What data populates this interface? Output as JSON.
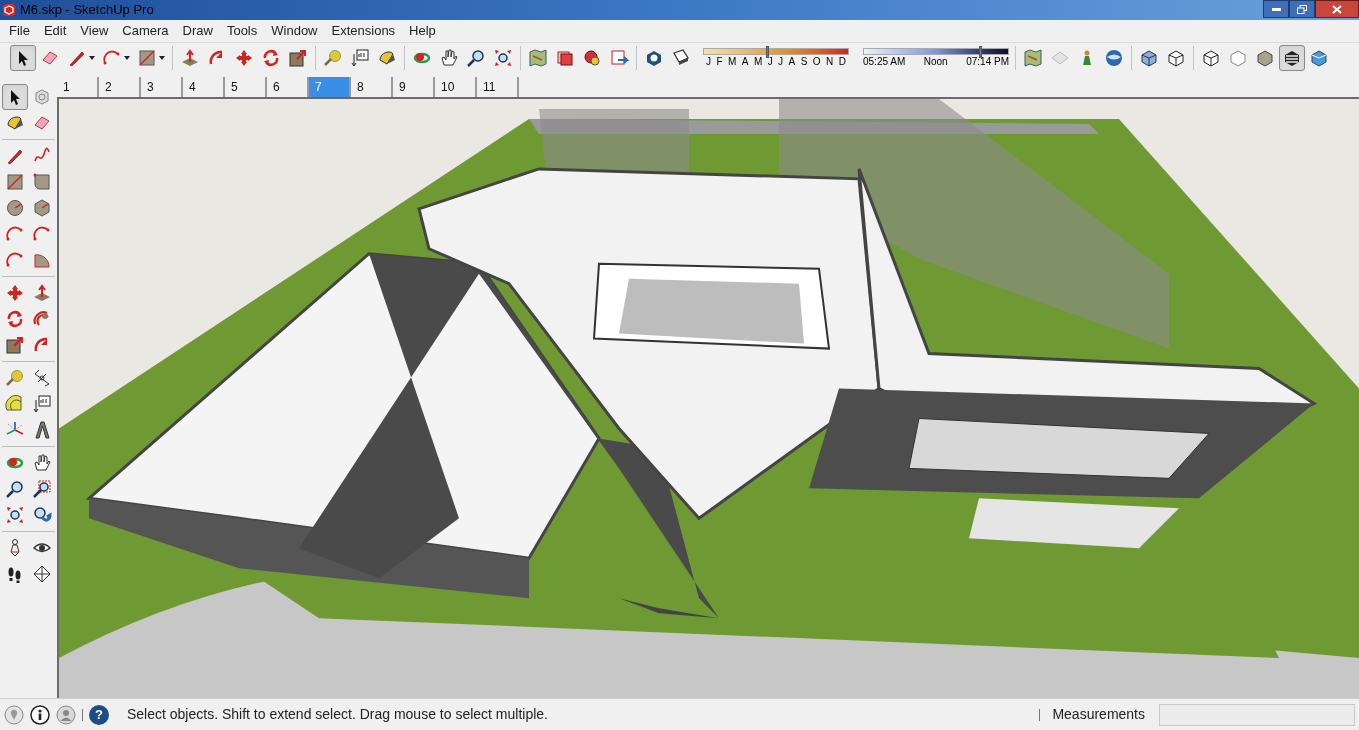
{
  "window": {
    "title": "M6.skp - SketchUp Pro"
  },
  "menu": [
    "File",
    "Edit",
    "View",
    "Camera",
    "Draw",
    "Tools",
    "Window",
    "Extensions",
    "Help"
  ],
  "toolbar_buttons": [
    {
      "selected": true
    },
    {
      "selected": false
    },
    {
      "selected": false
    },
    {
      "selected": false
    },
    {
      "selected": false
    },
    {
      "selected": false
    },
    {
      "selected": false
    },
    {
      "selected": false
    },
    {
      "selected": false
    },
    {
      "selected": false
    },
    {
      "selected": false
    },
    {
      "selected": false
    },
    {
      "selected": false
    },
    {
      "selected": false
    },
    {
      "selected": false
    },
    {
      "selected": false
    },
    {
      "selected": false
    },
    {
      "selected": false
    },
    {
      "selected": false
    },
    {
      "selected": false
    },
    {
      "selected": false
    },
    {
      "selected": false
    },
    {
      "selected": false
    },
    {
      "selected": false
    },
    {
      "selected": false
    },
    {
      "selected": false
    },
    {
      "selected": false
    },
    {
      "selected": false
    },
    {
      "selected": false
    },
    {
      "selected": false
    },
    {
      "selected": false
    },
    {
      "selected": false
    },
    {
      "selected": true
    },
    {
      "selected": false
    }
  ],
  "shadows": {
    "months": [
      "J",
      "F",
      "M",
      "A",
      "M",
      "J",
      "J",
      "A",
      "S",
      "O",
      "N",
      "D"
    ],
    "month_slider": {
      "level": 0.43
    },
    "times": [
      "05:25 AM",
      "Noon",
      "07:14 PM"
    ],
    "time_slider": {
      "level": 0.8
    }
  },
  "scenes": [
    {
      "label": "1",
      "selected": false
    },
    {
      "label": "2",
      "selected": false
    },
    {
      "label": "3",
      "selected": false
    },
    {
      "label": "4",
      "selected": false
    },
    {
      "label": "5",
      "selected": false
    },
    {
      "label": "6",
      "selected": false
    },
    {
      "label": "7",
      "selected": true
    },
    {
      "label": "8",
      "selected": false
    },
    {
      "label": "9",
      "selected": false
    },
    {
      "label": "10",
      "selected": false
    },
    {
      "label": "11",
      "selected": false
    }
  ],
  "palette_buttons": [
    {
      "selected": true
    },
    {
      "selected": false
    },
    {
      "selected": false
    },
    {
      "selected": false
    },
    {
      "selected": false
    },
    {
      "selected": false
    },
    {
      "selected": false
    },
    {
      "selected": false
    },
    {
      "selected": false
    },
    {
      "selected": false
    },
    {
      "selected": false
    },
    {
      "selected": false
    },
    {
      "selected": false
    },
    {
      "selected": false
    },
    {
      "selected": false
    },
    {
      "selected": false
    },
    {
      "selected": false
    },
    {
      "selected": false
    },
    {
      "selected": false
    },
    {
      "selected": false
    },
    {
      "selected": false
    },
    {
      "selected": false
    },
    {
      "selected": false
    },
    {
      "selected": false
    },
    {
      "selected": false
    },
    {
      "selected": false
    },
    {
      "selected": false
    },
    {
      "selected": false
    },
    {
      "selected": false
    },
    {
      "selected": false
    },
    {
      "selected": false
    },
    {
      "selected": false
    },
    {
      "selected": false
    },
    {
      "selected": false
    },
    {
      "selected": false
    },
    {
      "selected": false
    }
  ],
  "status_bar": {
    "help_glyph": "?",
    "message": "Select objects. Shift to extend select. Drag mouse to select multiple.",
    "measurements_label": "Measurements"
  }
}
